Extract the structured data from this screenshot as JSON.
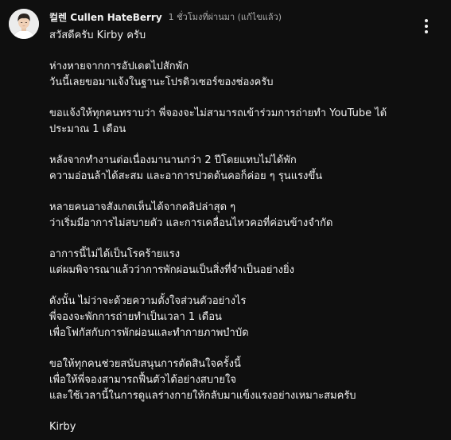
{
  "comment": {
    "author": "컬렌 Cullen HateBerry",
    "timestamp": "1 ชั่วโมงที่ผ่านมา (แก้ไขแล้ว)",
    "avatar_icon": "profile-avatar",
    "more_icon": "more-vert-icon",
    "lines": [
      "สวัสดีครับ Kirby ครับ",
      "",
      "ห่างหายจากการอัปเดตไปสักพัก",
      "วันนี้เลยขอมาแจ้งในฐานะโปรดิวเซอร์ของช่องครับ",
      "",
      "ขอแจ้งให้ทุกคนทราบว่า พี่จองจะไม่สามารถเข้าร่วมการถ่ายทำ YouTube ได้",
      "ประมาณ 1 เดือน",
      "",
      "หลังจากทำงานต่อเนื่องมานานกว่า 2 ปีโดยแทบไม่ได้พัก",
      "ความอ่อนล้าได้สะสม และอาการปวดต้นคอก็ค่อย ๆ รุนแรงขึ้น",
      "",
      "หลายคนอาจสังเกตเห็นได้จากคลิปล่าสุด ๆ",
      "ว่าเริ่มมีอาการไม่สบายตัว และการเคลื่อนไหวคอที่ค่อนข้างจำกัด",
      "",
      "อาการนี้ไม่ได้เป็นโรคร้ายแรง",
      "แต่ผมพิจารณาแล้วว่าการพักผ่อนเป็นสิ่งที่จำเป็นอย่างยิ่ง",
      "",
      "ดังนั้น ไม่ว่าจะด้วยความตั้งใจส่วนตัวอย่างไร",
      "พี่จองจะพักการถ่ายทำเป็นเวลา 1 เดือน",
      "เพื่อโฟกัสกับการพักผ่อนและทำกายภาพบำบัด",
      "",
      "ขอให้ทุกคนช่วยสนับสนุนการตัดสินใจครั้งนี้",
      "เพื่อให้พี่จองสามารถฟื้นตัวได้อย่างสบายใจ",
      "และใช้เวลานี้ในการดูแลร่างกายให้กลับมาแข็งแรงอย่างเหมาะสมครับ",
      "",
      "Kirby"
    ]
  }
}
